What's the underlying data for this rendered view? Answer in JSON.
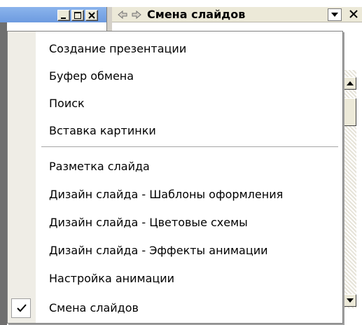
{
  "pane": {
    "title": "Смена слайдов"
  },
  "menu": {
    "items": [
      {
        "label": "Создание презентации",
        "checked": false
      },
      {
        "label": "Буфер обмена",
        "checked": false
      },
      {
        "label": "Поиск",
        "checked": false
      },
      {
        "label": "Вставка картинки",
        "checked": false
      },
      {
        "label": "Разметка слайда",
        "checked": false
      },
      {
        "label": "Дизайн слайда - Шаблоны оформления",
        "checked": false
      },
      {
        "label": "Дизайн слайда - Цветовые схемы",
        "checked": false
      },
      {
        "label": "Дизайн слайда - Эффекты анимации",
        "checked": false
      },
      {
        "label": "Настройка анимации",
        "checked": false
      },
      {
        "label": "Смена слайдов",
        "checked": true
      }
    ]
  },
  "icons": {
    "minimize": "minimize-icon",
    "maximize": "maximize-icon",
    "close": "close-icon",
    "back": "back-arrow-icon",
    "forward": "forward-arrow-icon",
    "dropdown": "chevron-down-icon",
    "check": "check-icon"
  },
  "colors": {
    "title_bar": "#7aa6e6",
    "menu_gutter": "#efede6",
    "menu_border": "#808080"
  }
}
